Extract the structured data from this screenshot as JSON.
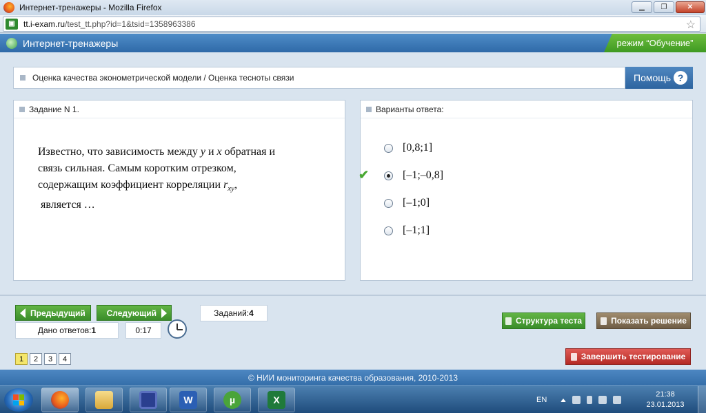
{
  "window": {
    "title": "Интернет-тренажеры - Mozilla Firefox",
    "min_label": "▁",
    "max_label": "❐",
    "close_label": "✕"
  },
  "browser": {
    "url_domain": "tt.i-exam.ru",
    "url_path": "/test_tt.php?id=1&tsid=1358963386",
    "bookmark_icon": "☆"
  },
  "app": {
    "title": "Интернет-тренажеры",
    "mode": "режим “Обучение”"
  },
  "breadcrumb": {
    "text": "Оценка качества эконометрической модели / Оценка тесноты связи"
  },
  "help": {
    "label": "Помощь",
    "icon": "?"
  },
  "task": {
    "header": "Задание N 1.",
    "line1_a": "Известно, что зависимость между ",
    "var_y": "y",
    "line1_b": " и ",
    "var_x": "x",
    "line1_c": " обратная и",
    "line2": "связь сильная. Самым коротким отрезком,",
    "line3": "содержащим коэффициент корреляции ",
    "var_r": "r",
    "var_r_sub": "xy",
    "line3_end": ",",
    "line4": "является …"
  },
  "answers": {
    "header": "Варианты ответа:",
    "check_icon": "✔",
    "options": [
      {
        "label": "[0,8;1]",
        "selected": false
      },
      {
        "label": "[–1;–0,8]",
        "selected": true
      },
      {
        "label": "[–1;0]",
        "selected": false
      },
      {
        "label": "[–1;1]",
        "selected": false
      }
    ]
  },
  "controls": {
    "prev_label": "Предыдущий",
    "next_label": "Следующий",
    "tasks_label": "Заданий: ",
    "tasks_count": "4",
    "answered_label": "Дано ответов: ",
    "answered_count": "1",
    "timer": "0:17",
    "structure_label": "Структура теста",
    "solution_label": "Показать решение",
    "finish_label": "Завершить тестирование",
    "pages": [
      "1",
      "2",
      "3",
      "4"
    ],
    "active_page": "1"
  },
  "footer": {
    "text": "© НИИ мониторинга качества образования, 2010-2013"
  },
  "taskbar": {
    "lang": "EN",
    "time": "21:38",
    "date": "23.01.2013",
    "word_glyph": "W",
    "torrent_glyph": "µ",
    "excel_glyph": "X"
  },
  "colors": {
    "accent_blue": "#346ea9",
    "green": "#3a8d2a",
    "brown": "#6f5d45",
    "red": "#b42a25",
    "active_page": "#f4e66a"
  }
}
